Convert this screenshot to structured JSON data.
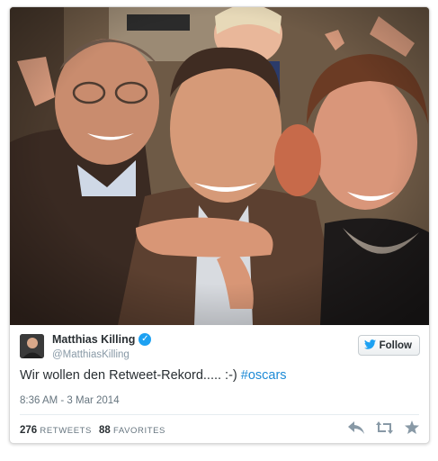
{
  "tweet": {
    "display_name": "Matthias Killing",
    "verified_icon": "check-icon",
    "handle": "@MatthiasKilling",
    "text_main": "Wir wollen den Retweet-Rekord..... :-) ",
    "hashtag": "#oscars",
    "timestamp": "8:36 AM - 3 Mar 2014",
    "retweets_count": "276",
    "retweets_label": "RETWEETS",
    "favorites_count": "88",
    "favorites_label": "FAVORITES"
  },
  "follow_button": {
    "label": "Follow",
    "icon": "twitter-bird-icon"
  },
  "actions": {
    "reply_icon": "reply-icon",
    "retweet_icon": "retweet-icon",
    "favorite_icon": "star-icon"
  },
  "colors": {
    "link": "#1d8ad6",
    "verified": "#1da1f2",
    "text": "#292f33",
    "muted": "#8899a6"
  }
}
